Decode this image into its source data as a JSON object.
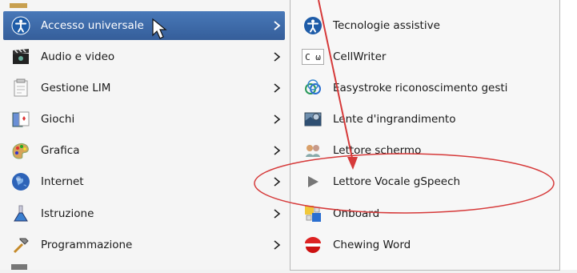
{
  "menu": {
    "items": [
      {
        "label": "Accesso universale",
        "icon": "accessibility-icon",
        "active": true
      },
      {
        "label": "Audio e video",
        "icon": "film-clapper-icon"
      },
      {
        "label": "Gestione LIM",
        "icon": "whiteboard-icon"
      },
      {
        "label": "Giochi",
        "icon": "playing-cards-icon"
      },
      {
        "label": "Grafica",
        "icon": "paint-palette-icon"
      },
      {
        "label": "Internet",
        "icon": "globe-icon"
      },
      {
        "label": "Istruzione",
        "icon": "flask-icon"
      },
      {
        "label": "Programmazione",
        "icon": "hammer-icon"
      }
    ]
  },
  "submenu": {
    "items": [
      {
        "label": "Tecnologie assistive",
        "icon": "accessibility-icon"
      },
      {
        "label": "CellWriter",
        "icon": "cellwriter-icon"
      },
      {
        "label": "Easystroke riconoscimento gesti",
        "icon": "easystroke-icon"
      },
      {
        "label": "Lente d'ingrandimento",
        "icon": "magnifier-icon"
      },
      {
        "label": "Lettore schermo",
        "icon": "screen-reader-icon"
      },
      {
        "label": "Lettore Vocale gSpeech",
        "icon": "play-icon"
      },
      {
        "label": "Onboard",
        "icon": "onboard-keyboard-icon"
      },
      {
        "label": "Chewing Word",
        "icon": "chewing-word-icon"
      }
    ]
  },
  "cellwriter_glyphs": "C ω",
  "annotation": {
    "color": "#d63a3a",
    "description": "red circle and arrow highlighting gSpeech"
  },
  "colors": {
    "active_bg": "#3f6fb0",
    "annotation": "#d63a3a"
  }
}
